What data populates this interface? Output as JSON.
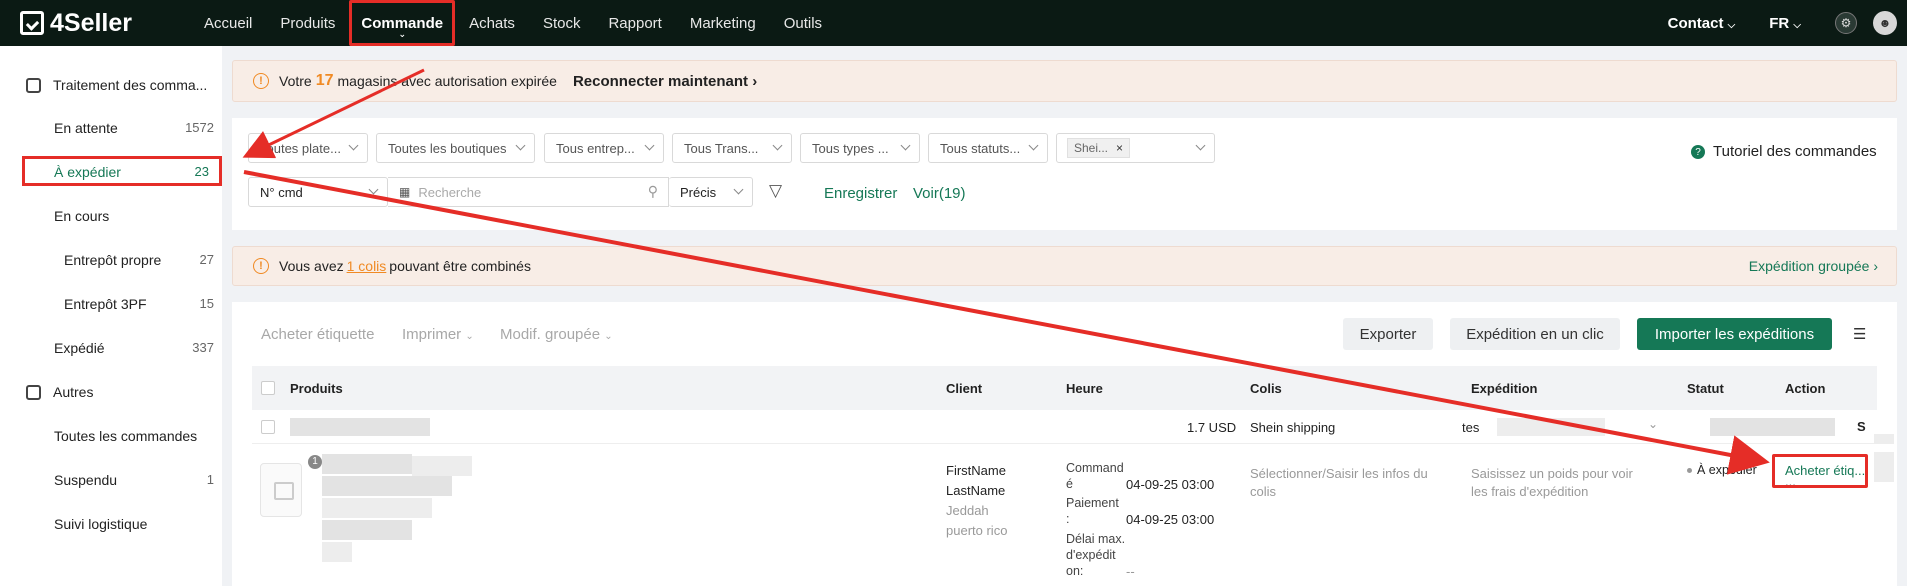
{
  "header": {
    "logo": "4Seller",
    "nav": [
      "Accueil",
      "Produits",
      "Commande",
      "Achats",
      "Stock",
      "Rapport",
      "Marketing",
      "Outils"
    ],
    "active_nav": "Commande",
    "contact": "Contact",
    "lang": "FR"
  },
  "sidebar": {
    "group1": "Traitement des comma...",
    "items": [
      {
        "label": "En attente",
        "count": "1572"
      },
      {
        "label": "À expédier",
        "count": "23"
      },
      {
        "label": "En cours",
        "count": ""
      },
      {
        "label": "Entrepôt propre",
        "count": "27"
      },
      {
        "label": "Entrepôt 3PF",
        "count": "15"
      },
      {
        "label": "Expédié",
        "count": "337"
      }
    ],
    "group2": "Autres",
    "others": [
      {
        "label": "Toutes les commandes",
        "count": ""
      },
      {
        "label": "Suspendu",
        "count": "1"
      },
      {
        "label": "Suivi logistique",
        "count": ""
      }
    ]
  },
  "banner1": {
    "pre": "Votre",
    "count": "17",
    "post": "magasins avec autorisation expirée",
    "action": "Reconnecter maintenant",
    "action_arrow": "›"
  },
  "filters": {
    "selects": [
      "Toutes plate...",
      "Toutes les boutiques",
      "Tous entrep...",
      "Tous Trans...",
      "Tous types ...",
      "Tous statuts..."
    ],
    "tag": "Shei...",
    "tag_close": "×",
    "field": "N° cmd",
    "search_placeholder": "Recherche",
    "match": "Précis",
    "save": "Enregistrer",
    "view": "Voir(19)",
    "tutorial": "Tutoriel des commandes"
  },
  "banner2": {
    "pre": "Vous avez",
    "link": "1 colis",
    "post": "pouvant être combinés",
    "right": "Expédition groupée ›"
  },
  "toolbar": {
    "buy_label": "Acheter étiquette",
    "print": "Imprimer",
    "bulk_edit": "Modif. groupée",
    "export": "Exporter",
    "one_click": "Expédition en un clic",
    "import": "Importer les expéditions"
  },
  "table": {
    "headers": [
      "Produits",
      "Client",
      "Heure",
      "Colis",
      "Expédition",
      "Statut",
      "Action"
    ],
    "group_row": {
      "amount": "1.7 USD",
      "carrier": "Shein shipping",
      "shipping_value": "tes",
      "trailing": "S"
    },
    "order": {
      "badge": "1",
      "first_name": "FirstName",
      "last_name": "LastName",
      "city": "Jeddah",
      "region": "puerto rico",
      "time_labels": [
        [
          "Command",
          "é"
        ],
        [
          "Paiement",
          ":"
        ],
        [
          "Délai max.",
          "d'expédit",
          "on:"
        ]
      ],
      "ordered_at": "04-09-25 03:00",
      "paid_at": "04-09-25 03:00",
      "deadline": "--",
      "parcel_hint": "Sélectionner/Saisir les infos du colis",
      "shipping_hint": "Saisissez un poids pour voir les frais d'expédition",
      "status": "À expédier",
      "action": "Acheter étiq...",
      "action_more": "..."
    }
  }
}
